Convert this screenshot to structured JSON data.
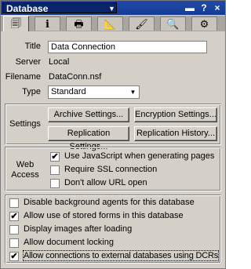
{
  "titlebar": {
    "title": "Database",
    "dropdown_glyph": "▼",
    "buttons": {
      "pin": "▬",
      "help": "?",
      "close": "×"
    }
  },
  "tabs": [
    {
      "icon": "basics-icon",
      "glyph": "🗐",
      "active": true
    },
    {
      "icon": "info-icon",
      "glyph": "i",
      "active": false
    },
    {
      "icon": "printer-icon",
      "glyph": "🖶",
      "active": false
    },
    {
      "icon": "design-icon",
      "glyph": "📐",
      "active": false
    },
    {
      "icon": "launch-icon",
      "glyph": "🖌",
      "active": false
    },
    {
      "icon": "search-icon",
      "glyph": "🔍",
      "active": false
    },
    {
      "icon": "advanced-icon",
      "glyph": "⚙",
      "active": false
    }
  ],
  "basics": {
    "title_label": "Title",
    "title_value": "Data Connection",
    "server_label": "Server",
    "server_value": "Local",
    "filename_label": "Filename",
    "filename_value": "DataConn.nsf",
    "type_label": "Type",
    "type_value": "Standard"
  },
  "settings": {
    "label": "Settings",
    "archive": "Archive Settings...",
    "encryption": "Encryption Settings...",
    "replication": "Replication Settings...",
    "replication_history": "Replication History..."
  },
  "web": {
    "label_line1": "Web",
    "label_line2": "Access",
    "use_js": "Use JavaScript when generating pages",
    "require_ssl": "Require SSL connection",
    "no_url_open": "Don't allow URL open",
    "use_js_checked": true,
    "require_ssl_checked": false,
    "no_url_open_checked": false
  },
  "options": {
    "disable_agents": "Disable background agents for this database",
    "stored_forms": "Allow use of stored forms in this database",
    "display_images": "Display images after loading",
    "doc_locking": "Allow document locking",
    "external_dbs": "Allow connections to external databases using DCRs",
    "checked": [
      false,
      true,
      false,
      false,
      true
    ]
  }
}
